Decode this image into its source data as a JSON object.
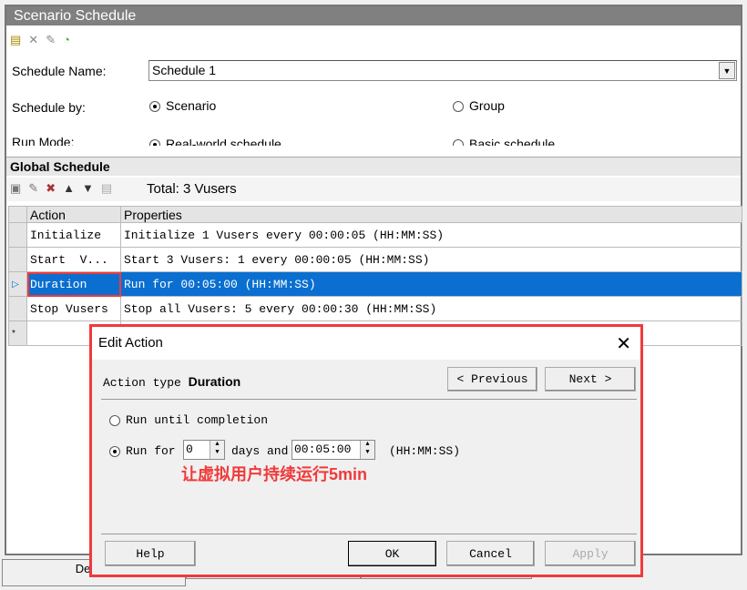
{
  "window": {
    "title": "Scenario Schedule"
  },
  "toolbar": {
    "icons": [
      "new-schedule-icon",
      "delete-icon",
      "rename-icon",
      "schedule-run-icon"
    ]
  },
  "form": {
    "schedule_name_label": "Schedule Name:",
    "schedule_name_value": "Schedule 1",
    "schedule_by_label": "Schedule by:",
    "schedule_by_options": [
      "Scenario",
      "Group"
    ],
    "schedule_by_selected": "Scenario",
    "run_mode_label": "Run Mode:",
    "run_mode_options": [
      "Real-world schedule",
      "Basic schedule"
    ],
    "run_mode_selected": "Real-world schedule"
  },
  "global": {
    "title": "Global Schedule",
    "total": "Total: 3 Vusers",
    "columns": [
      "Action",
      "Properties"
    ],
    "rows": [
      {
        "action": "Initialize",
        "properties": "Initialize 1 Vusers every 00:00:05 (HH:MM:SS)"
      },
      {
        "action": "Start  V...",
        "properties": "Start 3 Vusers: 1 every 00:00:05 (HH:MM:SS)"
      },
      {
        "action": "Duration",
        "properties": "Run for 00:05:00 (HH:MM:SS)"
      },
      {
        "action": "Stop Vusers",
        "properties": "Stop all Vusers: 5 every 00:00:30 (HH:MM:SS)"
      }
    ],
    "new_row_marker": "*"
  },
  "dialog": {
    "title": "Edit Action",
    "action_type_label": "Action type",
    "action_type_value": "Duration",
    "previous": "<  Previous",
    "next": "Next  >",
    "opt_until": "Run until completion",
    "opt_runfor": "Run for",
    "days_value": "0",
    "days_label": "days and",
    "time_value": "00:05:00",
    "time_unit": "(HH:MM:SS)",
    "annotation": "让虚拟用户持续运行5min",
    "help": "Help",
    "ok": "OK",
    "cancel": "Cancel",
    "apply": "Apply"
  },
  "bottom_tabs": [
    "Design"
  ],
  "colors": {
    "selection": "#0a6fd0",
    "highlight": "#f03a3a",
    "annotation": "#f03a3a"
  }
}
